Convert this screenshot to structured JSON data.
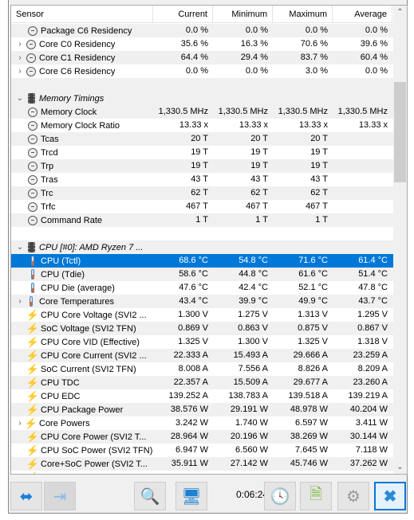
{
  "columns": [
    "Sensor",
    "Current",
    "Minimum",
    "Maximum",
    "Average"
  ],
  "rows": [
    {
      "indent": 1,
      "icon": "clock-icon",
      "label": "Package C6 Residency",
      "v": [
        "0.0 %",
        "0.0 %",
        "0.0 %",
        "0.0 %"
      ]
    },
    {
      "indent": 2,
      "expand": true,
      "icon": "clock-icon",
      "label": "Core C0 Residency",
      "v": [
        "35.6 %",
        "16.3 %",
        "70.6 %",
        "39.6 %"
      ]
    },
    {
      "indent": 2,
      "expand": true,
      "icon": "clock-icon",
      "label": "Core C1 Residency",
      "v": [
        "64.4 %",
        "29.4 %",
        "83.7 %",
        "60.4 %"
      ]
    },
    {
      "indent": 2,
      "expand": true,
      "icon": "clock-icon",
      "label": "Core C6 Residency",
      "v": [
        "0.0 %",
        "0.0 %",
        "3.0 %",
        "0.0 %"
      ]
    },
    {
      "blank": true
    },
    {
      "group": true,
      "icon": "chip-icon",
      "label": "Memory Timings",
      "v": [
        "",
        "",
        "",
        ""
      ]
    },
    {
      "indent": 1,
      "icon": "clock-icon",
      "label": "Memory Clock",
      "v": [
        "1,330.5 MHz",
        "1,330.5 MHz",
        "1,330.5 MHz",
        "1,330.5 MHz"
      ]
    },
    {
      "indent": 1,
      "icon": "clock-icon",
      "label": "Memory Clock Ratio",
      "v": [
        "13.33 x",
        "13.33 x",
        "13.33 x",
        "13.33 x"
      ]
    },
    {
      "indent": 1,
      "icon": "clock-icon",
      "label": "Tcas",
      "v": [
        "20 T",
        "20 T",
        "20 T",
        ""
      ]
    },
    {
      "indent": 1,
      "icon": "clock-icon",
      "label": "Trcd",
      "v": [
        "19 T",
        "19 T",
        "19 T",
        ""
      ]
    },
    {
      "indent": 1,
      "icon": "clock-icon",
      "label": "Trp",
      "v": [
        "19 T",
        "19 T",
        "19 T",
        ""
      ]
    },
    {
      "indent": 1,
      "icon": "clock-icon",
      "label": "Tras",
      "v": [
        "43 T",
        "43 T",
        "43 T",
        ""
      ]
    },
    {
      "indent": 1,
      "icon": "clock-icon",
      "label": "Trc",
      "v": [
        "62 T",
        "62 T",
        "62 T",
        ""
      ]
    },
    {
      "indent": 1,
      "icon": "clock-icon",
      "label": "Trfc",
      "v": [
        "467 T",
        "467 T",
        "467 T",
        ""
      ]
    },
    {
      "indent": 1,
      "icon": "clock-icon",
      "label": "Command Rate",
      "v": [
        "1 T",
        "1 T",
        "1 T",
        ""
      ]
    },
    {
      "blank": true
    },
    {
      "group": true,
      "icon": "chip-icon",
      "label": "CPU [#0]: AMD Ryzen 7 ...",
      "v": [
        "",
        "",
        "",
        ""
      ]
    },
    {
      "indent": 1,
      "icon": "thermometer-icon",
      "label": "CPU (Tctl)",
      "selected": true,
      "v": [
        "68.6 °C",
        "54.8 °C",
        "71.6 °C",
        "61.4 °C"
      ]
    },
    {
      "indent": 1,
      "icon": "thermometer-icon",
      "label": "CPU (Tdie)",
      "v": [
        "58.6 °C",
        "44.8 °C",
        "61.6 °C",
        "51.4 °C"
      ]
    },
    {
      "indent": 1,
      "icon": "thermometer-icon",
      "label": "CPU Die (average)",
      "v": [
        "47.6 °C",
        "42.4 °C",
        "52.1 °C",
        "47.8 °C"
      ]
    },
    {
      "indent": 2,
      "expand": true,
      "icon": "thermometer-icon",
      "label": "Core Temperatures",
      "v": [
        "43.4 °C",
        "39.9 °C",
        "49.9 °C",
        "43.7 °C"
      ]
    },
    {
      "indent": 1,
      "icon": "bolt-icon",
      "label": "CPU Core Voltage (SVI2 ...",
      "v": [
        "1.300 V",
        "1.275 V",
        "1.313 V",
        "1.295 V"
      ]
    },
    {
      "indent": 1,
      "icon": "bolt-icon",
      "label": "SoC Voltage (SVI2 TFN)",
      "v": [
        "0.869 V",
        "0.863 V",
        "0.875 V",
        "0.867 V"
      ]
    },
    {
      "indent": 1,
      "icon": "bolt-icon",
      "label": "CPU Core VID (Effective)",
      "v": [
        "1.325 V",
        "1.300 V",
        "1.325 V",
        "1.318 V"
      ]
    },
    {
      "indent": 1,
      "icon": "bolt-icon",
      "label": "CPU Core Current (SVI2 ...",
      "v": [
        "22.333 A",
        "15.493 A",
        "29.666 A",
        "23.259 A"
      ]
    },
    {
      "indent": 1,
      "icon": "bolt-icon",
      "label": "SoC Current (SVI2 TFN)",
      "v": [
        "8.008 A",
        "7.556 A",
        "8.826 A",
        "8.209 A"
      ]
    },
    {
      "indent": 1,
      "icon": "bolt-icon",
      "label": "CPU TDC",
      "v": [
        "22.357 A",
        "15.509 A",
        "29.677 A",
        "23.260 A"
      ]
    },
    {
      "indent": 1,
      "icon": "bolt-icon",
      "label": "CPU EDC",
      "v": [
        "139.252 A",
        "138.783 A",
        "139.518 A",
        "139.219 A"
      ]
    },
    {
      "indent": 1,
      "icon": "bolt-icon",
      "label": "CPU Package Power",
      "v": [
        "38.576 W",
        "29.191 W",
        "48.978 W",
        "40.204 W"
      ]
    },
    {
      "indent": 2,
      "expand": true,
      "icon": "bolt-icon",
      "label": "Core Powers",
      "v": [
        "3.242 W",
        "1.740 W",
        "6.597 W",
        "3.411 W"
      ]
    },
    {
      "indent": 1,
      "icon": "bolt-icon",
      "label": "CPU Core Power (SVI2 T...",
      "v": [
        "28.964 W",
        "20.196 W",
        "38.269 W",
        "30.144 W"
      ]
    },
    {
      "indent": 1,
      "icon": "bolt-icon",
      "label": "CPU SoC Power (SVI2 TFN)",
      "v": [
        "6.947 W",
        "6.560 W",
        "7.645 W",
        "7.118 W"
      ]
    },
    {
      "indent": 1,
      "icon": "bolt-icon",
      "label": "Core+SoC Power (SVI2 T...",
      "v": [
        "35.911 W",
        "27.142 W",
        "45.746 W",
        "37.262 W"
      ]
    },
    {
      "indent": 1,
      "icon": "bolt-icon",
      "label": "",
      "v": [
        "",
        "",
        "",
        ""
      ]
    }
  ],
  "toolbar": {
    "timer": "0:06:24"
  }
}
